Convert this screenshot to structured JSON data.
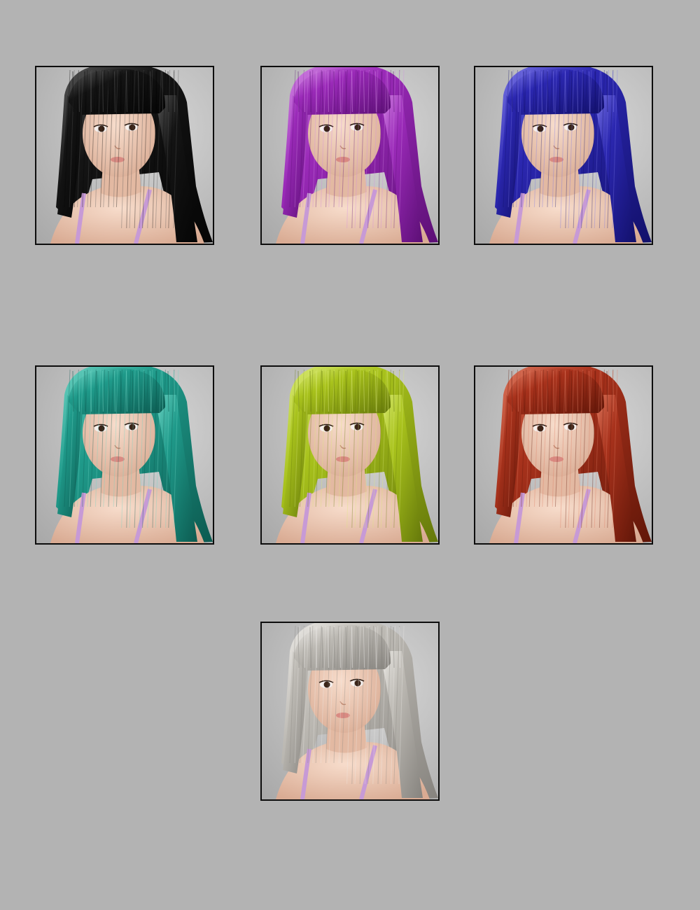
{
  "colors": {
    "page_background": "#b3b3b3",
    "frame_border": "#0d0d0d",
    "studio_backdrop": "#c9c9c9",
    "skin": "#f0cdb8",
    "top_strap": "#c79ad6"
  },
  "hair_variants": [
    {
      "name": "black",
      "base": "#141414",
      "shade": "#050505",
      "light": "#5a5a5a"
    },
    {
      "name": "purple",
      "base": "#9a2ab8",
      "shade": "#5c0f75",
      "light": "#d58ae6"
    },
    {
      "name": "blue",
      "base": "#2b27b0",
      "shade": "#12106a",
      "light": "#7c78e8"
    },
    {
      "name": "teal",
      "base": "#1f9a8a",
      "shade": "#0c5a50",
      "light": "#6fd6c6"
    },
    {
      "name": "lime",
      "base": "#a8c21c",
      "shade": "#64770a",
      "light": "#dcec78"
    },
    {
      "name": "red",
      "base": "#a8321c",
      "shade": "#611608",
      "light": "#e07a60"
    },
    {
      "name": "silver",
      "base": "#bdbab4",
      "shade": "#86837e",
      "light": "#eeece8"
    }
  ]
}
